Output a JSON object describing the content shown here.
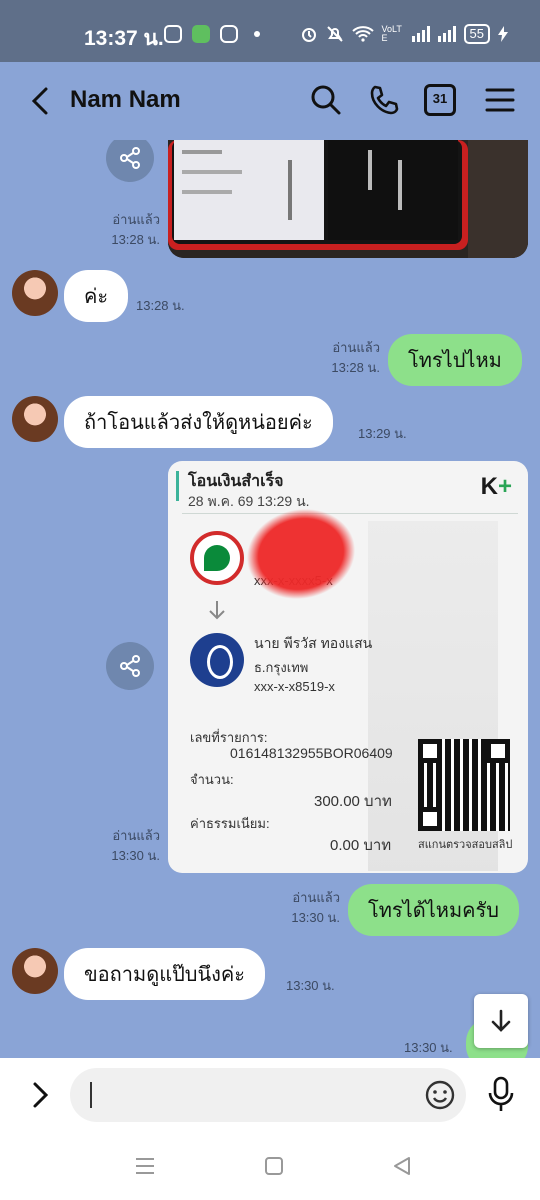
{
  "status_bar": {
    "time": "13:37 น.",
    "battery": "55",
    "network": "VoLTE"
  },
  "header": {
    "contact_name": "Nam Nam",
    "calendar_day": "31"
  },
  "messages": [
    {
      "id": "m1",
      "type": "image",
      "direction": "out",
      "read": "อ่านแล้ว",
      "time": "13:28 น."
    },
    {
      "id": "m2",
      "type": "text",
      "direction": "in",
      "text": "ค่ะ",
      "time": "13:28 น."
    },
    {
      "id": "m3",
      "type": "text",
      "direction": "out",
      "text": "โทรไปไหม",
      "read": "อ่านแล้ว",
      "time": "13:28 น."
    },
    {
      "id": "m4",
      "type": "text",
      "direction": "in",
      "text": "ถ้าโอนแล้วส่งให้ดูหน่อยค่ะ",
      "time": "13:29 น."
    },
    {
      "id": "m5",
      "type": "slip",
      "direction": "out",
      "read": "อ่านแล้ว",
      "time": "13:30 น."
    },
    {
      "id": "m6",
      "type": "text",
      "direction": "out",
      "text": "โทรได้ไหมครับ",
      "read": "อ่านแล้ว",
      "time": "13:30 น."
    },
    {
      "id": "m7",
      "type": "text",
      "direction": "in",
      "text": "ขอถามดูแป๊บนึงค่ะ",
      "time": "13:30 น."
    },
    {
      "id": "m8",
      "type": "text",
      "direction": "out",
      "text": "",
      "time": "13:30 น."
    }
  ],
  "slip": {
    "title": "โอนเงินสำเร็จ",
    "datetime": "28 พ.ค. 69  13:29 น.",
    "brand": "K",
    "brand_plus": "+",
    "sender_account": "xxx-x-xxxx5-x",
    "receiver_name": "นาย พีรวัส ทองแสน",
    "receiver_bank": "ธ.กรุงเทพ",
    "receiver_account": "xxx-x-x8519-x",
    "ref_label": "เลขที่รายการ:",
    "ref_value": "016148132955BOR06409",
    "amount_label": "จำนวน:",
    "amount_value": "300.00 บาท",
    "fee_label": "ค่าธรรมเนียม:",
    "fee_value": "0.00 บาท",
    "qr_caption": "สแกนตรวจสอบสลิป"
  },
  "input": {
    "placeholder": ""
  }
}
